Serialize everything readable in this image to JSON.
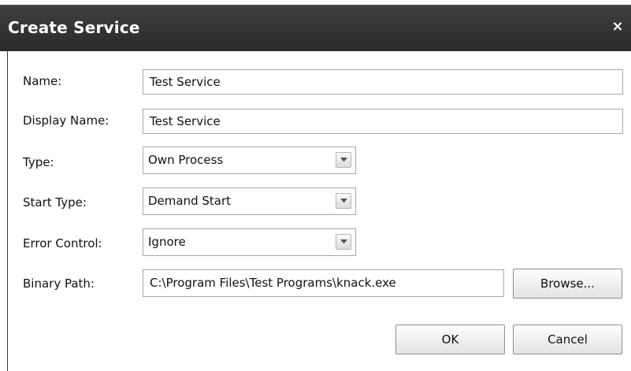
{
  "dialog": {
    "title": "Create Service",
    "close_icon": "close-icon",
    "close_glyph": "×"
  },
  "form": {
    "name": {
      "label": "Name:",
      "value": "Test Service"
    },
    "display_name": {
      "label": "Display Name:",
      "value": "Test Service"
    },
    "type": {
      "label": "Type:",
      "value": "Own Process"
    },
    "start_type": {
      "label": "Start Type:",
      "value": "Demand Start"
    },
    "error_control": {
      "label": "Error Control:",
      "value": "Ignore"
    },
    "binary_path": {
      "label": "Binary Path:",
      "value": "C:\\Program Files\\Test Programs\\knack.exe"
    }
  },
  "buttons": {
    "browse_label": "Browse...",
    "ok_label": "OK",
    "cancel_label": "Cancel"
  },
  "colors": {
    "title_bar": "#333333",
    "title_text": "#ffffff"
  }
}
